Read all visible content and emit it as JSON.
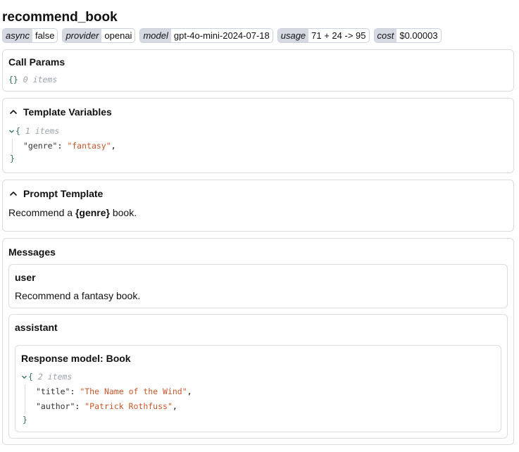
{
  "title": "recommend_book",
  "badges": [
    {
      "key": "async",
      "value": "false"
    },
    {
      "key": "provider",
      "value": "openai"
    },
    {
      "key": "model",
      "value": "gpt-4o-mini-2024-07-18"
    },
    {
      "key": "usage",
      "value": "71 + 24 -> 95"
    },
    {
      "key": "cost",
      "value": "$0.00003"
    }
  ],
  "call_params": {
    "title": "Call Params",
    "braces": "{}",
    "count": "0 items"
  },
  "template_variables": {
    "title": "Template Variables",
    "open": "{",
    "close": "}",
    "count": "1 items",
    "entries": [
      {
        "key": "\"genre\"",
        "value": "\"fantasy\""
      }
    ]
  },
  "prompt_template": {
    "title": "Prompt Template",
    "before": "Recommend a ",
    "variable": "{genre}",
    "after": " book."
  },
  "messages": {
    "title": "Messages",
    "user": {
      "role": "user",
      "content": "Recommend a fantasy book."
    },
    "assistant": {
      "role": "assistant",
      "response_title": "Response model: Book",
      "open": "{",
      "close": "}",
      "count": "2 items",
      "entries": [
        {
          "key": "\"title\"",
          "value": "\"The Name of the Wind\""
        },
        {
          "key": "\"author\"",
          "value": "\"Patrick Rothfuss\""
        }
      ]
    }
  }
}
